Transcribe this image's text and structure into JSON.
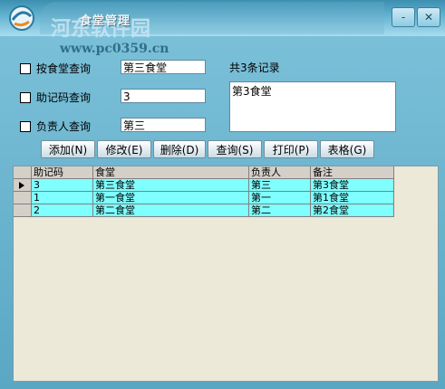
{
  "window": {
    "title": "食堂管理",
    "watermark": "河东软件园",
    "watermark_url": "www.pc0359.cn",
    "min_label": "-",
    "close_label": "✕"
  },
  "search": {
    "by_name_label": "按食堂查询",
    "by_name_value": "第三食堂",
    "by_code_label": "助记码查询",
    "by_code_value": "3",
    "by_manager_label": "负责人查询",
    "by_manager_value": "第三"
  },
  "summary": {
    "count_text": "共3条记录",
    "memo_text": "第3食堂"
  },
  "toolbar": {
    "add_label": "添加(N)",
    "edit_label": "修改(E)",
    "delete_label": "删除(D)",
    "query_label": "查询(S)",
    "print_label": "打印(P)",
    "table_label": "表格(G)"
  },
  "grid": {
    "headers": [
      "助记码",
      "食堂",
      "负责人",
      "备注"
    ],
    "rows": [
      [
        "3",
        "第三食堂",
        "第三",
        "第3食堂"
      ],
      [
        "1",
        "第一食堂",
        "第一",
        "第1食堂"
      ],
      [
        "2",
        "第二食堂",
        "第二",
        "第2食堂"
      ]
    ]
  },
  "colors": {
    "row_highlight": "#80ffff",
    "grid_background": "#ece9d8",
    "window_blue": "#6fb6cf"
  }
}
